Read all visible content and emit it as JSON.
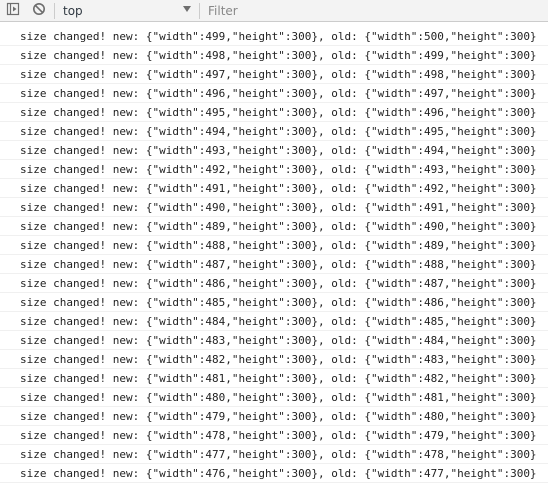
{
  "toolbar": {
    "play_icon": "sidebar-toggle-icon",
    "clear_icon": "clear-console-icon",
    "context": "top",
    "filter_placeholder": "Filter"
  },
  "log": [
    {
      "msg": "size changed! new: {\"width\":499,\"height\":300}, old: {\"width\":500,\"height\":300}"
    },
    {
      "msg": "size changed! new: {\"width\":498,\"height\":300}, old: {\"width\":499,\"height\":300}"
    },
    {
      "msg": "size changed! new: {\"width\":497,\"height\":300}, old: {\"width\":498,\"height\":300}"
    },
    {
      "msg": "size changed! new: {\"width\":496,\"height\":300}, old: {\"width\":497,\"height\":300}"
    },
    {
      "msg": "size changed! new: {\"width\":495,\"height\":300}, old: {\"width\":496,\"height\":300}"
    },
    {
      "msg": "size changed! new: {\"width\":494,\"height\":300}, old: {\"width\":495,\"height\":300}"
    },
    {
      "msg": "size changed! new: {\"width\":493,\"height\":300}, old: {\"width\":494,\"height\":300}"
    },
    {
      "msg": "size changed! new: {\"width\":492,\"height\":300}, old: {\"width\":493,\"height\":300}"
    },
    {
      "msg": "size changed! new: {\"width\":491,\"height\":300}, old: {\"width\":492,\"height\":300}"
    },
    {
      "msg": "size changed! new: {\"width\":490,\"height\":300}, old: {\"width\":491,\"height\":300}"
    },
    {
      "msg": "size changed! new: {\"width\":489,\"height\":300}, old: {\"width\":490,\"height\":300}"
    },
    {
      "msg": "size changed! new: {\"width\":488,\"height\":300}, old: {\"width\":489,\"height\":300}"
    },
    {
      "msg": "size changed! new: {\"width\":487,\"height\":300}, old: {\"width\":488,\"height\":300}"
    },
    {
      "msg": "size changed! new: {\"width\":486,\"height\":300}, old: {\"width\":487,\"height\":300}"
    },
    {
      "msg": "size changed! new: {\"width\":485,\"height\":300}, old: {\"width\":486,\"height\":300}"
    },
    {
      "msg": "size changed! new: {\"width\":484,\"height\":300}, old: {\"width\":485,\"height\":300}"
    },
    {
      "msg": "size changed! new: {\"width\":483,\"height\":300}, old: {\"width\":484,\"height\":300}"
    },
    {
      "msg": "size changed! new: {\"width\":482,\"height\":300}, old: {\"width\":483,\"height\":300}"
    },
    {
      "msg": "size changed! new: {\"width\":481,\"height\":300}, old: {\"width\":482,\"height\":300}"
    },
    {
      "msg": "size changed! new: {\"width\":480,\"height\":300}, old: {\"width\":481,\"height\":300}"
    },
    {
      "msg": "size changed! new: {\"width\":479,\"height\":300}, old: {\"width\":480,\"height\":300}"
    },
    {
      "msg": "size changed! new: {\"width\":478,\"height\":300}, old: {\"width\":479,\"height\":300}"
    },
    {
      "msg": "size changed! new: {\"width\":477,\"height\":300}, old: {\"width\":478,\"height\":300}"
    },
    {
      "msg": "size changed! new: {\"width\":476,\"height\":300}, old: {\"width\":477,\"height\":300}"
    }
  ]
}
